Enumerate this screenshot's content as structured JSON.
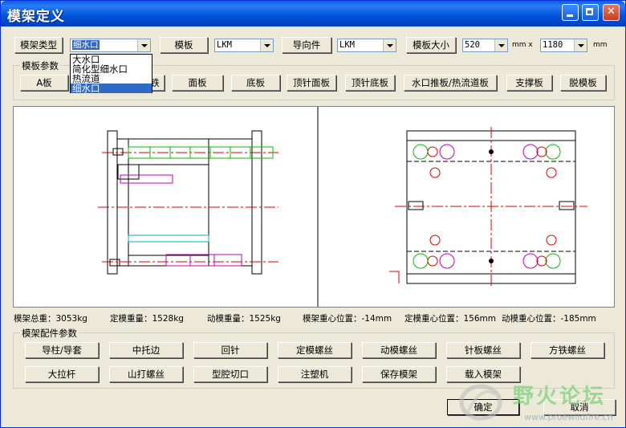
{
  "window": {
    "title": "模架定义"
  },
  "top_controls": {
    "mold_type_button": "模架类型",
    "mold_type_value": "细水口",
    "template_button": "模板",
    "template_value": "LKM",
    "guide_button": "导向件",
    "guide_value": "LKM",
    "plate_size_button": "模板大小",
    "size_w": "520",
    "unit1": "mm x",
    "size_h": "1180",
    "unit2": "mm"
  },
  "dropdown_options": [
    "大水口",
    "简化型细水口",
    "热流道",
    "细水口"
  ],
  "template_params": {
    "title": "模板参数",
    "buttons": [
      "A板",
      "铁",
      "面板",
      "底板",
      "顶针面板",
      "顶针底板",
      "水口推板/热流道板",
      "支撑板",
      "脱模板"
    ]
  },
  "status": {
    "total_weight": "模架总重：3053kg",
    "fixed_weight": "定模重量：1528kg",
    "moving_weight": "动模重量：1525kg",
    "center_gravity": "模架重心位置：-14mm",
    "fixed_center": "定模重心位置：156mm",
    "moving_center": "动模重心位置：-185mm"
  },
  "accessories": {
    "title": "模架配件参数",
    "row1": [
      "导柱/导套",
      "中托边",
      "回针",
      "定模螺丝",
      "动模螺丝",
      "针板螺丝",
      "方铁螺丝"
    ],
    "row2": [
      "大拉杆",
      "山打螺丝",
      "型腔切口",
      "注塑机",
      "保存模架",
      "载入模架"
    ]
  },
  "dialog": {
    "ok": "确定",
    "cancel": "取消"
  },
  "watermark": {
    "text": "野火论坛",
    "url": "www.proewildfire.cn"
  },
  "colors": {
    "titlebar": "#0052d9",
    "accent_green": "#00c000",
    "accent_red": "#e00000",
    "accent_magenta": "#c000c0",
    "accent_cyan": "#00b0c0"
  }
}
